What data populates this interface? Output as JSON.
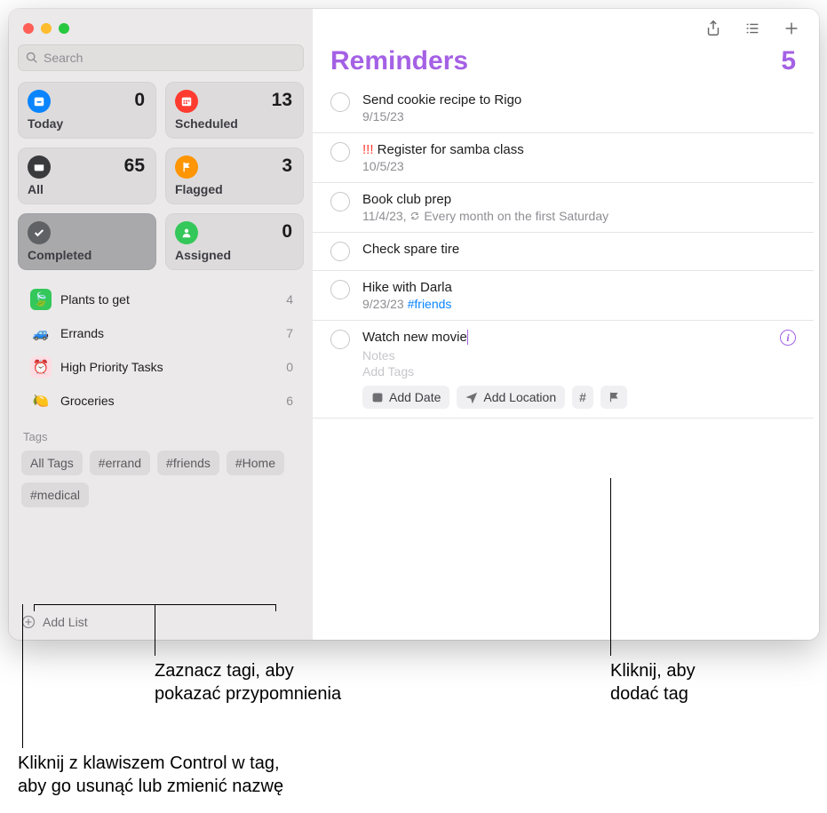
{
  "window": {
    "search_placeholder": "Search"
  },
  "smart_lists": [
    {
      "key": "today",
      "label": "Today",
      "count": "0",
      "color": "#0a84ff",
      "icon": "calendar-today"
    },
    {
      "key": "scheduled",
      "label": "Scheduled",
      "count": "13",
      "color": "#ff3b30",
      "icon": "calendar"
    },
    {
      "key": "all",
      "label": "All",
      "count": "65",
      "color": "#3a3a3c",
      "icon": "tray"
    },
    {
      "key": "flagged",
      "label": "Flagged",
      "count": "3",
      "color": "#ff9500",
      "icon": "flag"
    },
    {
      "key": "completed",
      "label": "Completed",
      "count": "",
      "color": "#5f6165",
      "icon": "check",
      "selected": true
    },
    {
      "key": "assigned",
      "label": "Assigned",
      "count": "0",
      "color": "#34c759",
      "icon": "person"
    }
  ],
  "lists": [
    {
      "name": "Plants to get",
      "count": "4",
      "icon": "🍃",
      "bg": "#34c759"
    },
    {
      "name": "Errands",
      "count": "7",
      "icon": "🚙",
      "bg": "#e5e5ea"
    },
    {
      "name": "High Priority Tasks",
      "count": "0",
      "icon": "⏰",
      "bg": "#ffb3c0"
    },
    {
      "name": "Groceries",
      "count": "6",
      "icon": "🍋",
      "bg": "#e5e5ea"
    }
  ],
  "tags_section": {
    "label": "Tags",
    "tags": [
      "All Tags",
      "#errand",
      "#friends",
      "#Home",
      "#medical"
    ]
  },
  "add_list_label": "Add List",
  "main": {
    "title": "Reminders",
    "count": "5"
  },
  "reminders": [
    {
      "title": "Send cookie recipe to Rigo",
      "subtitle": "9/15/23"
    },
    {
      "title": "Register for samba class",
      "priority": "!!! ",
      "subtitle": "10/5/23"
    },
    {
      "title": "Book club prep",
      "subtitle_prefix": "11/4/23, ",
      "subtitle_suffix": " Every month on the first Saturday",
      "repeat": true
    },
    {
      "title": "Check spare tire"
    },
    {
      "title": "Hike with Darla",
      "subtitle": "9/23/23 ",
      "tag": "#friends"
    }
  ],
  "editing": {
    "title": "Watch new movie",
    "notes_placeholder": "Notes",
    "addtags_placeholder": "Add Tags",
    "add_date": "Add Date",
    "add_location": "Add Location",
    "hash": "#"
  },
  "callouts": {
    "c1_line1": "Zaznacz tagi, aby",
    "c1_line2": "pokazać przypomnienia",
    "c2_line1": "Kliknij, aby",
    "c2_line2": "dodać tag",
    "c3_line1": "Kliknij z klawiszem Control w tag,",
    "c3_line2": "aby go usunąć lub zmienić nazwę"
  }
}
